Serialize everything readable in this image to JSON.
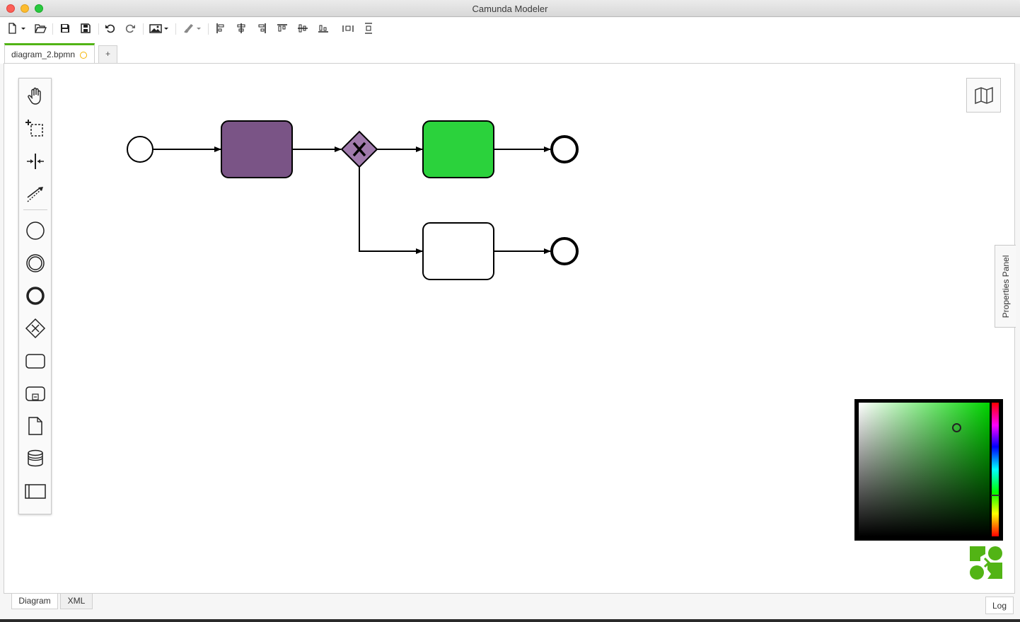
{
  "window": {
    "title": "Camunda Modeler"
  },
  "toolbar": {
    "items": [
      "new-file",
      "open-file",
      "save",
      "save-as",
      "undo",
      "redo",
      "export-image",
      "color",
      "align-left",
      "align-center",
      "align-right",
      "align-top",
      "align-middle",
      "align-bottom",
      "distribute-horizontal",
      "distribute-vertical"
    ]
  },
  "tabs": [
    {
      "label": "diagram_2.bpmn",
      "unsaved": true
    }
  ],
  "add_tab_label": "+",
  "palette": {
    "items": [
      "hand-tool",
      "lasso-tool",
      "space-tool",
      "global-connect-tool",
      "start-event",
      "intermediate-event",
      "end-event",
      "exclusive-gateway",
      "task",
      "subprocess",
      "data-object",
      "data-store",
      "pool-participant"
    ]
  },
  "properties_panel": {
    "label": "Properties Panel"
  },
  "diagram": {
    "colors": {
      "task_purple": "#7a5486",
      "task_green": "#2bd23c",
      "gateway_purple": "#a07aac",
      "stroke": "#000000"
    }
  },
  "color_picker": {
    "selected_hue": "#00d400"
  },
  "bottom_tabs": [
    {
      "label": "Diagram",
      "active": true
    },
    {
      "label": "XML",
      "active": false
    }
  ],
  "log_label": "Log",
  "brand_color": "#52b415"
}
